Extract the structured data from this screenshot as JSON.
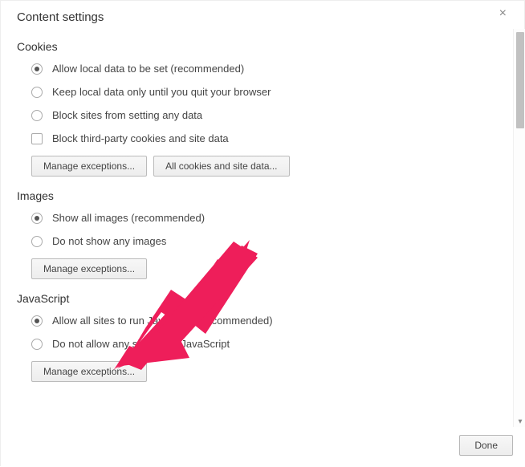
{
  "dialog": {
    "title": "Content settings",
    "close_glyph": "×",
    "done_label": "Done"
  },
  "sections": {
    "cookies": {
      "title": "Cookies",
      "options": [
        "Allow local data to be set (recommended)",
        "Keep local data only until you quit your browser",
        "Block sites from setting any data"
      ],
      "selected": 0,
      "checkbox_label": "Block third-party cookies and site data",
      "btn_manage": "Manage exceptions...",
      "btn_allcookies": "All cookies and site data..."
    },
    "images": {
      "title": "Images",
      "options": [
        "Show all images (recommended)",
        "Do not show any images"
      ],
      "selected": 0,
      "btn_manage": "Manage exceptions..."
    },
    "javascript": {
      "title": "JavaScript",
      "options": [
        "Allow all sites to run JavaScript (recommended)",
        "Do not allow any site to run JavaScript"
      ],
      "selected": 0,
      "btn_manage": "Manage exceptions..."
    }
  },
  "annotation": {
    "color": "#ee1e5a"
  }
}
